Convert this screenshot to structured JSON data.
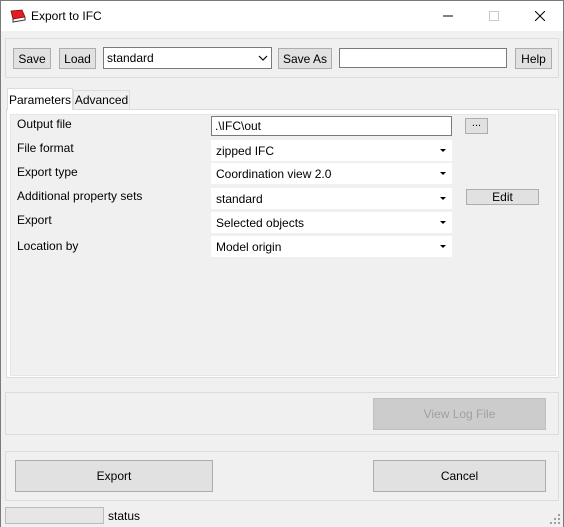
{
  "window": {
    "title": "Export to IFC"
  },
  "toolbar": {
    "save_label": "Save",
    "load_label": "Load",
    "settings_value": "standard",
    "save_as_label": "Save As",
    "save_as_value": "",
    "help_label": "Help"
  },
  "tabs": [
    {
      "label": "Parameters",
      "active": true
    },
    {
      "label": "Advanced",
      "active": false
    }
  ],
  "parameters": {
    "output_file_label": "Output file",
    "output_file_value": ".\\IFC\\out",
    "browse_label": "...",
    "file_format_label": "File format",
    "file_format_value": "zipped IFC",
    "export_type_label": "Export type",
    "export_type_value": "Coordination view 2.0",
    "property_sets_label": "Additional property sets",
    "property_sets_value": "standard",
    "edit_label": "Edit",
    "export_label": "Export",
    "export_value": "Selected objects",
    "location_label": "Location by",
    "location_value": "Model origin"
  },
  "log": {
    "view_log_label": "View Log File"
  },
  "actions": {
    "export_label": "Export",
    "cancel_label": "Cancel"
  },
  "status": {
    "text": "status"
  },
  "icons": {
    "app": "ifc-export-icon",
    "minimize": "minimize-icon",
    "maximize": "maximize-icon",
    "close": "close-icon",
    "dropdown": "chevron-down-icon",
    "grip": "resize-grip-icon"
  },
  "colors": {
    "app_icon": "#e31c23",
    "window_bg": "#f0f0f0",
    "button_bg": "#e1e1e1"
  }
}
